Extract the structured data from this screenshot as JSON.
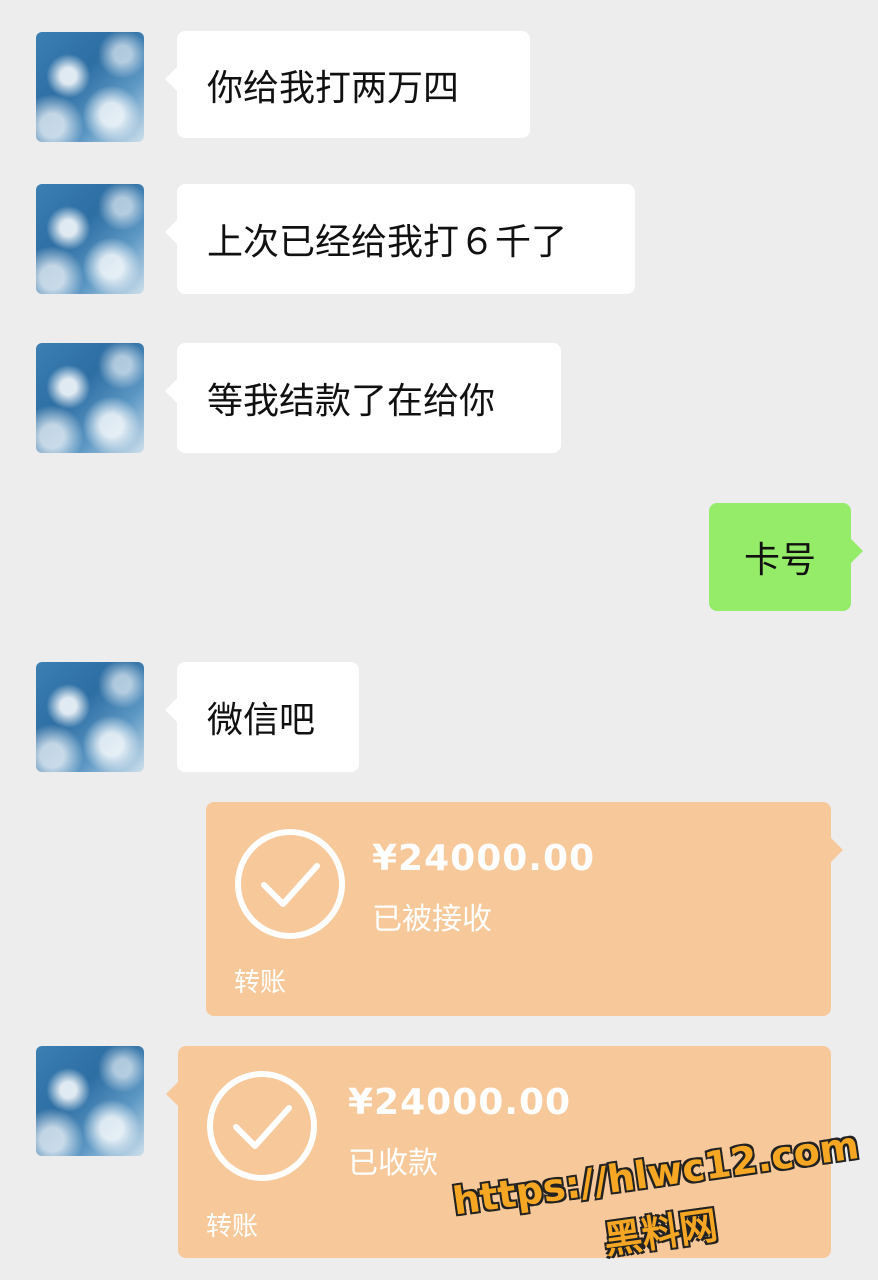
{
  "messages": [
    {
      "text": "你给我打两万四"
    },
    {
      "text": "上次已经给我打６千了"
    },
    {
      "text": "等我结款了在给你"
    },
    {
      "text": "卡号"
    },
    {
      "text": "微信吧"
    }
  ],
  "transfers": [
    {
      "amount": "¥24000.00",
      "status": "已被接收",
      "type": "转账"
    },
    {
      "amount": "¥24000.00",
      "status": "已收款",
      "type": "转账"
    }
  ],
  "watermark": {
    "url": "https://hlwc12.com",
    "label": "黑料网"
  },
  "colors": {
    "background": "#ededed",
    "incoming_bubble": "#ffffff",
    "outgoing_bubble": "#95ec69",
    "transfer_card": "#f7c89a",
    "watermark": "#f5a623"
  }
}
